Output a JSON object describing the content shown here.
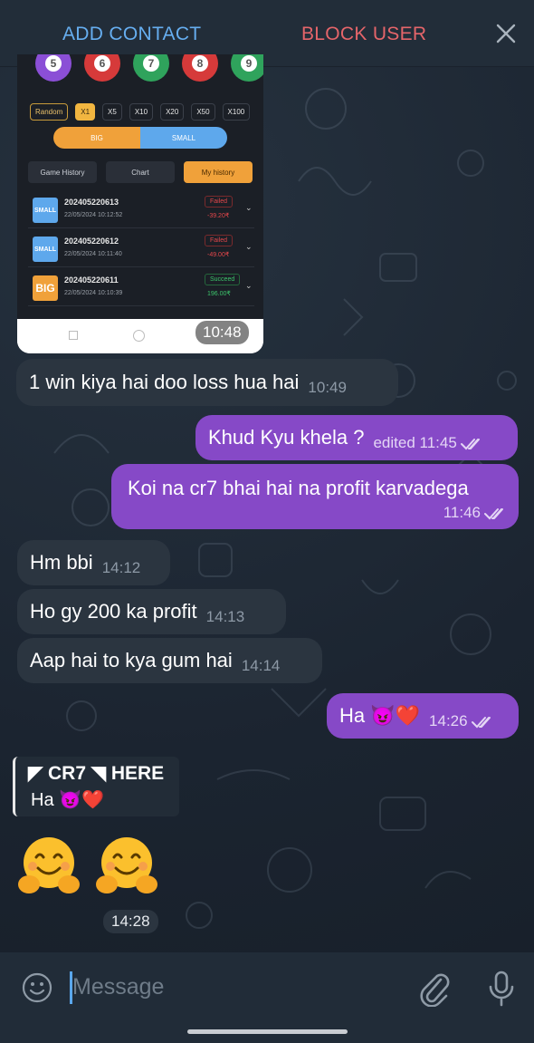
{
  "action_bar": {
    "add_contact": "ADD CONTACT",
    "block_user": "BLOCK USER",
    "close_icon": "close-icon"
  },
  "image_message": {
    "time": "10:48",
    "screenshot": {
      "balls": [
        "5",
        "6",
        "7",
        "8",
        "9"
      ],
      "ball_colors": [
        "#8b4fd6",
        "#d63a3a",
        "#2fa35c",
        "#d63a3a",
        "#2fa35c"
      ],
      "multipliers": [
        "Random",
        "X1",
        "X5",
        "X10",
        "X20",
        "X50",
        "X100"
      ],
      "selected_multiplier": "X1",
      "big_label": "BIG",
      "small_label": "SMALL",
      "tabs": [
        "Game History",
        "Chart",
        "My history"
      ],
      "active_tab": "My history",
      "history": [
        {
          "badge": "SMALL",
          "id": "202405220613",
          "datetime": "22/05/2024 10:12:52",
          "status": "Failed",
          "amount": "-39.20₹"
        },
        {
          "badge": "SMALL",
          "id": "202405220612",
          "datetime": "22/05/2024 10:11:40",
          "status": "Failed",
          "amount": "-49.00₹"
        },
        {
          "badge": "BIG",
          "id": "202405220611",
          "datetime": "22/05/2024 10:10:39",
          "status": "Succeed",
          "amount": "196.00₹"
        }
      ]
    }
  },
  "messages": [
    {
      "dir": "in",
      "text": "1 win kiya hai doo loss hua hai",
      "time": "10:49"
    },
    {
      "dir": "out",
      "text": "Khud Kyu khela ?",
      "time": "edited 11:45",
      "read": true
    },
    {
      "dir": "out",
      "text": "Koi na cr7 bhai hai na profit karvadega",
      "time": "11:46",
      "read": true
    },
    {
      "dir": "in",
      "text": "Hm bbi",
      "time": "14:12"
    },
    {
      "dir": "in",
      "text": "Ho gy 200 ka profit",
      "time": "14:13"
    },
    {
      "dir": "in",
      "text": "Aap hai to kya gum hai",
      "time": "14:14"
    },
    {
      "dir": "out",
      "text": "Ha 😈❤️",
      "time": "14:26",
      "read": true
    }
  ],
  "quote": {
    "name": "◤ CR7 ◥ HERE",
    "text": "Ha 😈❤️"
  },
  "emoji_message": {
    "time": "14:28",
    "emoji_names": [
      "hugging-face-icon",
      "hugging-face-icon"
    ]
  },
  "input": {
    "placeholder": "Message"
  },
  "colors": {
    "outgoing_bubble": "#8649c7",
    "incoming_bubble": "#2b3540",
    "add_contact": "#66aef0",
    "block_user": "#e5656a"
  }
}
